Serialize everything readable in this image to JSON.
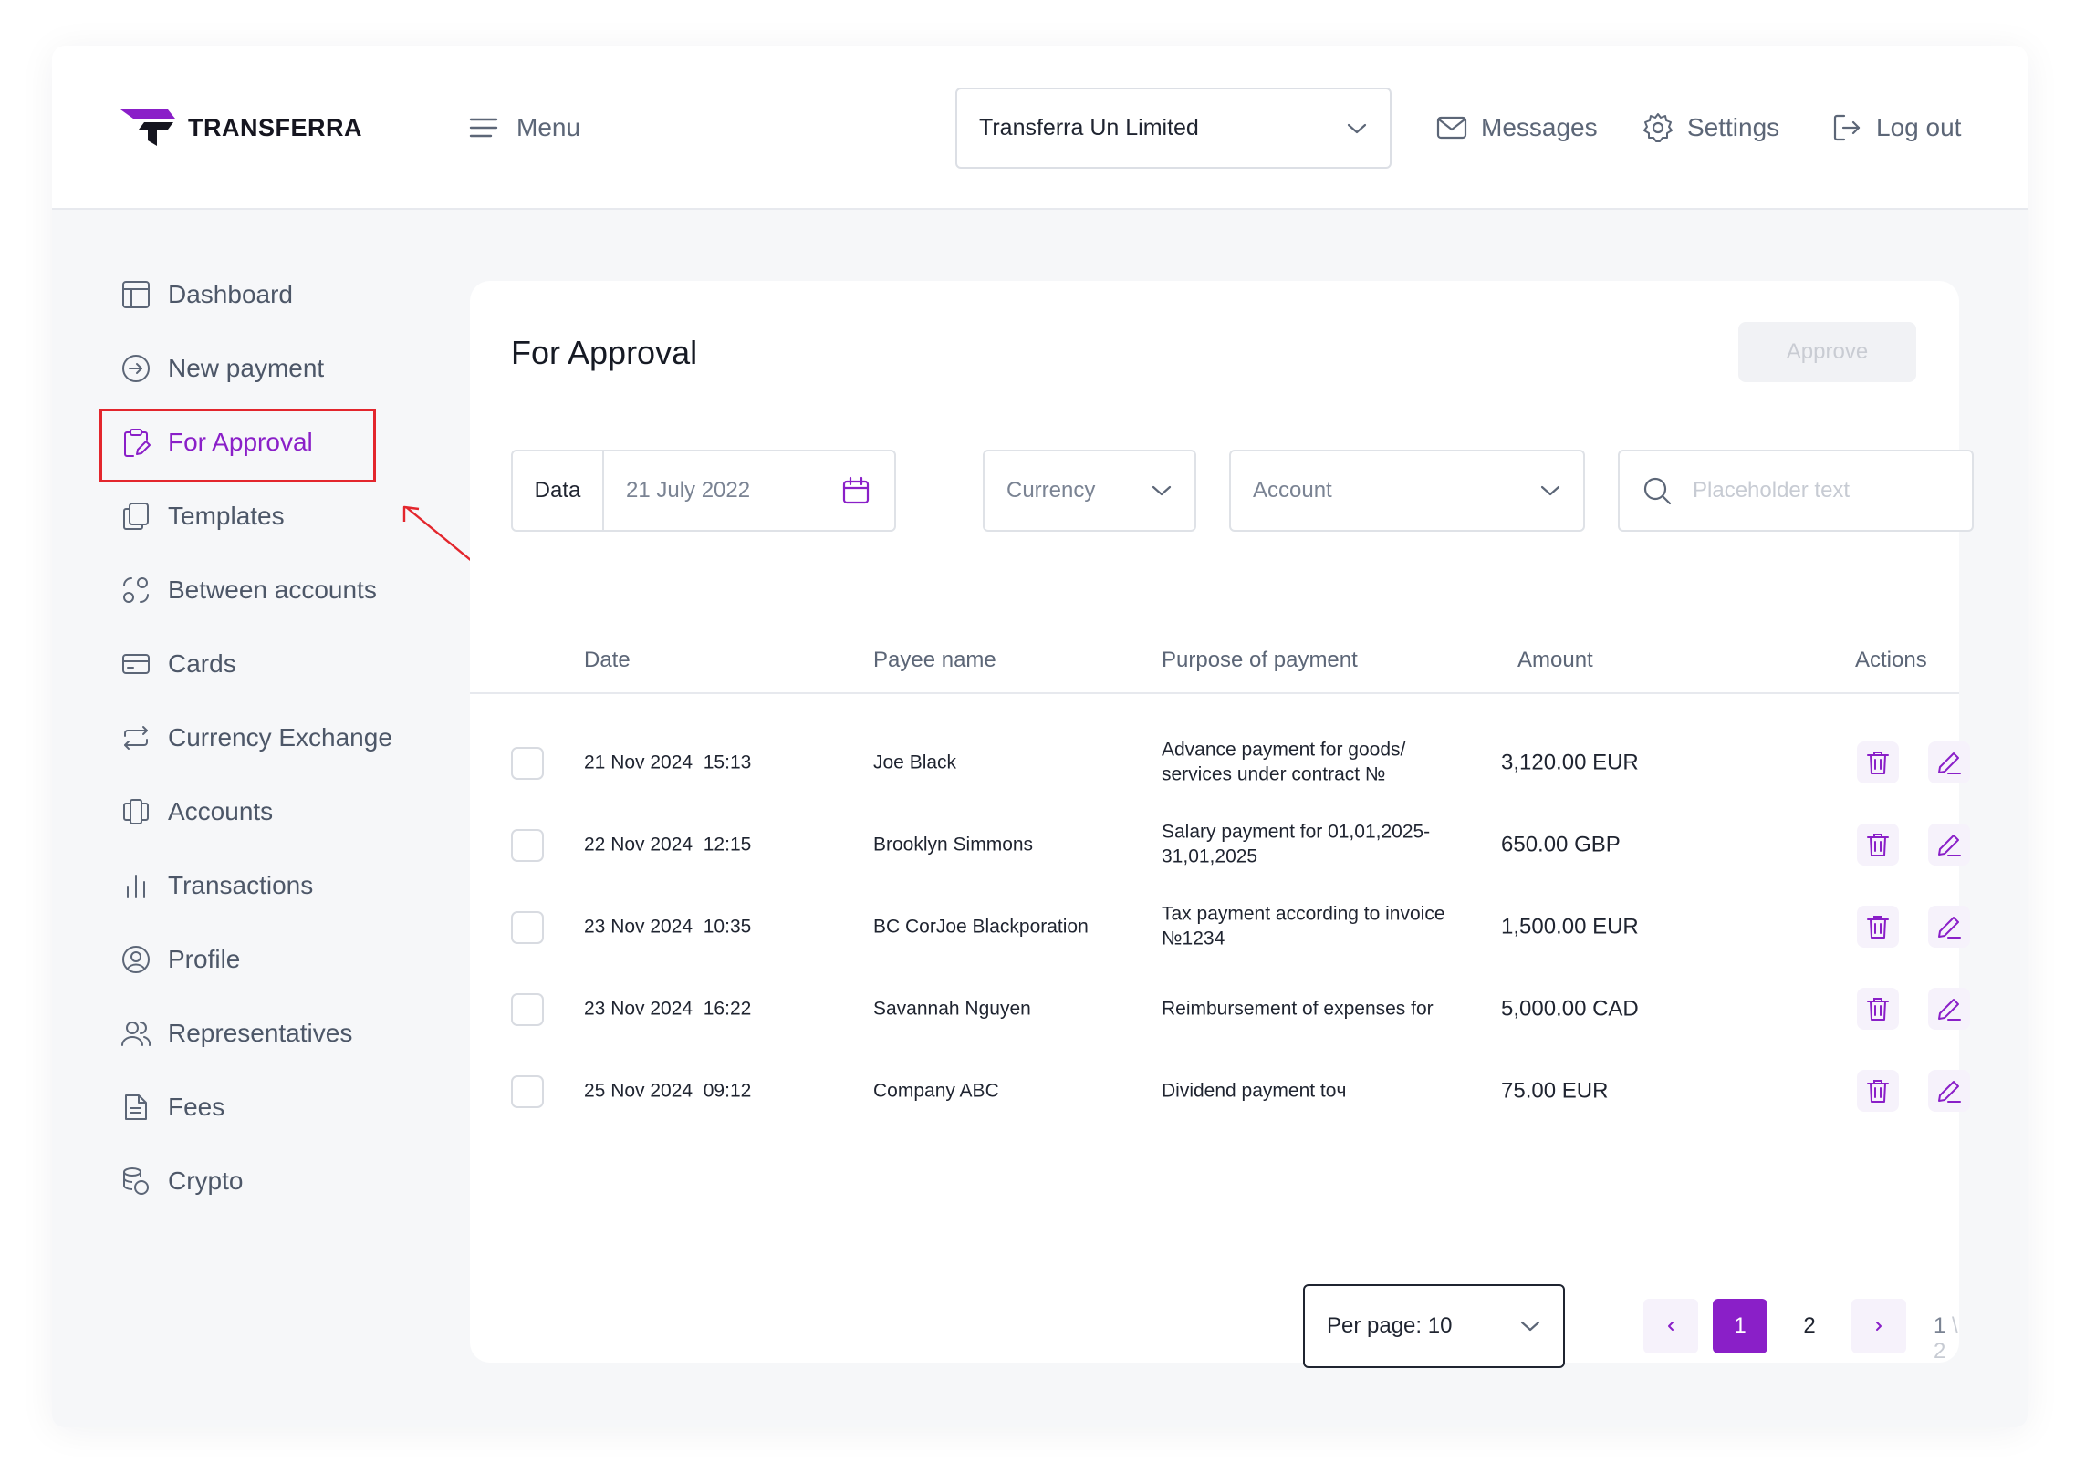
{
  "header": {
    "logo_text": "TRANSFERRA",
    "menu_label": "Menu",
    "company": "Transferra Un Limited",
    "messages_label": "Messages",
    "settings_label": "Settings",
    "logout_label": "Log out"
  },
  "sidebar": {
    "items": [
      {
        "label": "Dashboard",
        "icon": "dashboard-icon"
      },
      {
        "label": "New payment",
        "icon": "arrow-circle-icon"
      },
      {
        "label": "For Approval",
        "icon": "clipboard-edit-icon",
        "active": true
      },
      {
        "label": "Templates",
        "icon": "copy-icon"
      },
      {
        "label": "Between accounts",
        "icon": "exchange-nodes-icon"
      },
      {
        "label": "Cards",
        "icon": "card-icon"
      },
      {
        "label": "Currency Exchange",
        "icon": "repeat-icon"
      },
      {
        "label": "Accounts",
        "icon": "accounts-icon"
      },
      {
        "label": "Transactions",
        "icon": "bars-icon"
      },
      {
        "label": "Profile",
        "icon": "user-circle-icon"
      },
      {
        "label": "Representatives",
        "icon": "users-icon"
      },
      {
        "label": "Fees",
        "icon": "document-icon"
      },
      {
        "label": "Crypto",
        "icon": "coins-icon"
      }
    ]
  },
  "main": {
    "title": "For Approval",
    "approve_label": "Approve",
    "filters": {
      "date_label": "Data",
      "date_value": "21 July 2022",
      "currency_placeholder": "Currency",
      "account_placeholder": "Account",
      "search_placeholder": "Placeholder text"
    },
    "columns": [
      "Date",
      "Payee name",
      "Purpose of payment",
      "Amount",
      "Actions"
    ],
    "rows": [
      {
        "date": "21 Nov 2024  15:13",
        "payee": "Joe Black",
        "purpose": "Advance payment for goods/ services under contract №",
        "amount": "3,120.00 EUR"
      },
      {
        "date": "22 Nov 2024  12:15",
        "payee": "Brooklyn Simmons",
        "purpose": "Salary payment for 01,01,2025-31,01,2025",
        "amount": "650.00 GBP"
      },
      {
        "date": "23 Nov 2024  10:35",
        "payee": "BC CorJoe Blackporation",
        "purpose": "Tax payment according to invoice №1234",
        "amount": "1,500.00 EUR"
      },
      {
        "date": "23 Nov 2024  16:22",
        "payee": "Savannah Nguyen",
        "purpose": "Reimbursement of expenses for",
        "amount": "5,000.00 CAD"
      },
      {
        "date": "25 Nov 2024  09:12",
        "payee": "Company ABC",
        "purpose": "Dividend payment toч",
        "amount": "75.00 EUR"
      }
    ],
    "pagination": {
      "per_page_label": "Per page: 10",
      "pages": [
        "1",
        "2"
      ],
      "current": "1",
      "info_current": "1",
      "info_sep_total": "\\ 2"
    }
  },
  "colors": {
    "accent": "#8a1fc8",
    "annotation": "#e3262d"
  }
}
